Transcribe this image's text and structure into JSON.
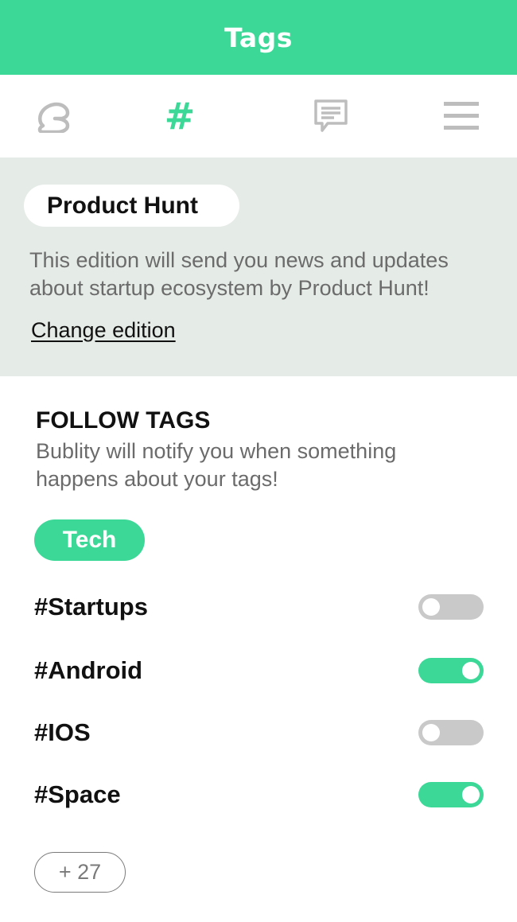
{
  "header": {
    "title": "Tags"
  },
  "tabs": [
    {
      "icon": "brand-logo-icon",
      "active": false
    },
    {
      "icon": "hashtag-icon",
      "glyph": "#",
      "active": true
    },
    {
      "icon": "chat-icon",
      "active": false
    },
    {
      "icon": "menu-icon",
      "active": false
    }
  ],
  "edition": {
    "name": "Product Hunt",
    "description": "This edition will send you news and updates about startup ecosystem by Product Hunt!",
    "change_link": "Change edition"
  },
  "follow": {
    "heading": "FOLLOW TAGS",
    "subtitle": "Bublity will notify you when something happens about your tags!",
    "category": "Tech",
    "tags": [
      {
        "label": "#Startups",
        "enabled": false
      },
      {
        "label": "#Android",
        "enabled": true
      },
      {
        "label": "#IOS",
        "enabled": false
      },
      {
        "label": "#Space",
        "enabled": true
      }
    ],
    "more_label": "+ 27"
  },
  "colors": {
    "accent": "#3bd897",
    "edition_bg": "#e5ebe6",
    "toggle_off": "#c9c9c9",
    "icon_gray": "#bdbdbd"
  }
}
